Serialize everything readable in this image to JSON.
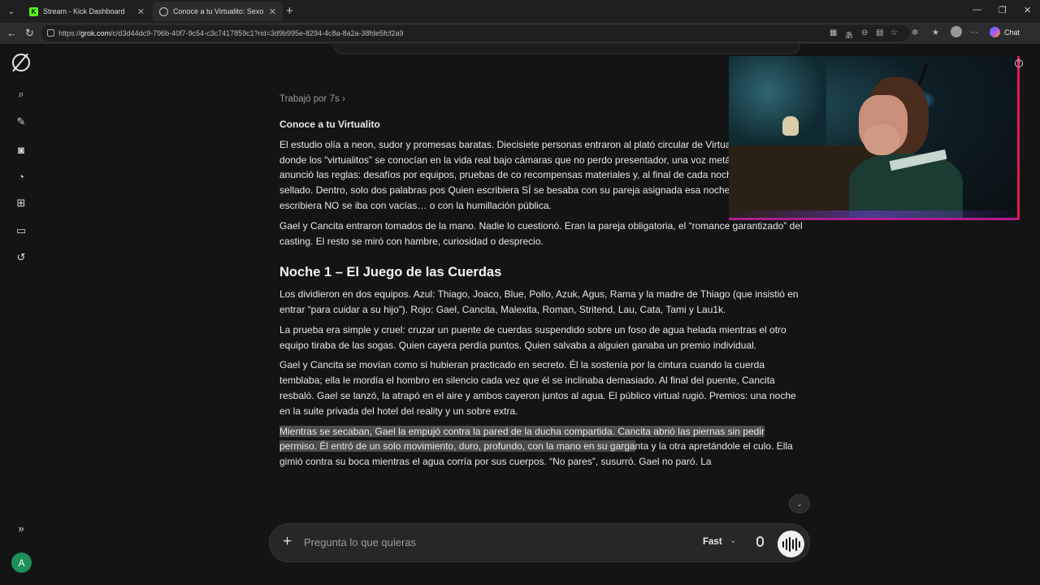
{
  "browser": {
    "tabs": [
      {
        "title": "Stream - Kick Dashboard",
        "active": false
      },
      {
        "title": "Conoce a tu Virtualito: Sexo y Bes",
        "active": true
      }
    ],
    "url_prefix": "https://",
    "url_domain": "grok.com",
    "url_rest": "/c/d3d44dc9-796b-40f7-9c54-c3c7417859c1?rid=3d9b995e-8294-4c8a-8a2a-38fde5fcf2a9",
    "chat_label": "Chat"
  },
  "sidebar": {
    "icons": [
      "grok-logo-icon",
      "search-icon",
      "new-chat-icon",
      "voice-icon",
      "history-chat-icon",
      "imagine-icon",
      "projects-icon",
      "history-icon"
    ],
    "expand_icon": "expand-icon",
    "avatar_letter": "A"
  },
  "response": {
    "worked_label": "Trabajó por 7s",
    "story_title": "Conoce a tu Virtualito",
    "paragraphs": [
      "El estudio olía a neon, sudor y promesas baratas. Diecisiete personas entraron al plató circular de Virtualito”, el reality donde los “virtualitos” se conocían en la vida real bajo cámaras que no perdo presentador, una voz metálica sin rostro, anunció las reglas: desafíos por equipos, pruebas de co recompensas materiales y, al final de cada noche, un sobre sellado. Dentro, solo dos palabras pos Quien escribiera SÍ se besaba con su pareja asignada esa noche. El que escribiera NO se iba con vacías… o con la humillación pública.",
      "Gael y Cancita entraron tomados de la mano. Nadie lo cuestionó. Eran la pareja obligatoria, el “romance garantizado” del casting. El resto se miró con hambre, curiosidad o desprecio."
    ],
    "section_title": "Noche 1 – El Juego de las Cuerdas",
    "section_paragraphs": [
      "Los dividieron en dos equipos. Azul: Thiago, Joaco, Blue, Pollo, Azuk, Agus, Rama y la madre de Thiago (que insistió en entrar “para cuidar a su hijo”). Rojo: Gael, Cancita, Malexita, Roman, Stritend, Lau, Cata, Tami y Lau1k.",
      "La prueba era simple y cruel: cruzar un puente de cuerdas suspendido sobre un foso de agua helada mientras el otro equipo tiraba de las sogas. Quien cayera perdía puntos. Quien salvaba a alguien ganaba un premio individual.",
      "Gael y Cancita se movían como si hubieran practicado en secreto. Él la sostenía por la cintura cuando la cuerda temblaba; ella le mordía el hombro en silencio cada vez que él se inclinaba demasiado. Al final del puente, Cancita resbaló. Gael se lanzó, la atrapó en el aire y ambos cayeron juntos al agua. El público virtual rugió. Premios: una noche en la suite privada del hotel del reality y un sobre extra."
    ],
    "highlighted_text": "Mientras se secaban, Gael la empujó contra la pared de la ducha compartida. Cancita abrió las piernas sin pedir permiso. Él entró de un solo movimiento, duro, profundo, con la mano en su garga",
    "after_highlight": "nta y la otra apretándole el culo. Ella gimió contra su boca mientras el agua corría por sus cuerpos. “No pares”, susurró. Gael no paró. La"
  },
  "composer": {
    "placeholder": "Pregunta lo que quieras",
    "mode_label": "Fast"
  }
}
